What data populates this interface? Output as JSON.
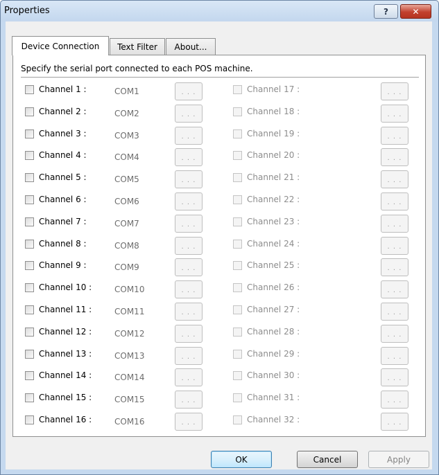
{
  "window": {
    "title": "Properties",
    "help_label": "?",
    "close_label": "✕"
  },
  "tabs": [
    {
      "label": "Device Connection"
    },
    {
      "label": "Text Filter"
    },
    {
      "label": "About..."
    }
  ],
  "instruction": "Specify the serial port connected to each POS machine.",
  "browse_label": ". . .",
  "left_channels": [
    {
      "label": "Channel 1 :",
      "port": "COM1"
    },
    {
      "label": "Channel 2 :",
      "port": "COM2"
    },
    {
      "label": "Channel 3 :",
      "port": "COM3"
    },
    {
      "label": "Channel 4 :",
      "port": "COM4"
    },
    {
      "label": "Channel 5 :",
      "port": "COM5"
    },
    {
      "label": "Channel 6 :",
      "port": "COM6"
    },
    {
      "label": "Channel 7 :",
      "port": "COM7"
    },
    {
      "label": "Channel 8 :",
      "port": "COM8"
    },
    {
      "label": "Channel 9 :",
      "port": "COM9"
    },
    {
      "label": "Channel 10 :",
      "port": "COM10"
    },
    {
      "label": "Channel 11 :",
      "port": "COM11"
    },
    {
      "label": "Channel 12 :",
      "port": "COM12"
    },
    {
      "label": "Channel 13 :",
      "port": "COM13"
    },
    {
      "label": "Channel 14 :",
      "port": "COM14"
    },
    {
      "label": "Channel 15 :",
      "port": "COM15"
    },
    {
      "label": "Channel 16 :",
      "port": "COM16"
    }
  ],
  "right_channels": [
    {
      "label": "Channel 17 :"
    },
    {
      "label": "Channel 18 :"
    },
    {
      "label": "Channel 19 :"
    },
    {
      "label": "Channel 20 :"
    },
    {
      "label": "Channel 21 :"
    },
    {
      "label": "Channel 22 :"
    },
    {
      "label": "Channel 23 :"
    },
    {
      "label": "Channel 24 :"
    },
    {
      "label": "Channel 25 :"
    },
    {
      "label": "Channel 26 :"
    },
    {
      "label": "Channel 27 :"
    },
    {
      "label": "Channel 28 :"
    },
    {
      "label": "Channel 29 :"
    },
    {
      "label": "Channel 30 :"
    },
    {
      "label": "Channel 31 :"
    },
    {
      "label": "Channel 32 :"
    }
  ],
  "buttons": {
    "ok": "OK",
    "cancel": "Cancel",
    "apply": "Apply"
  }
}
